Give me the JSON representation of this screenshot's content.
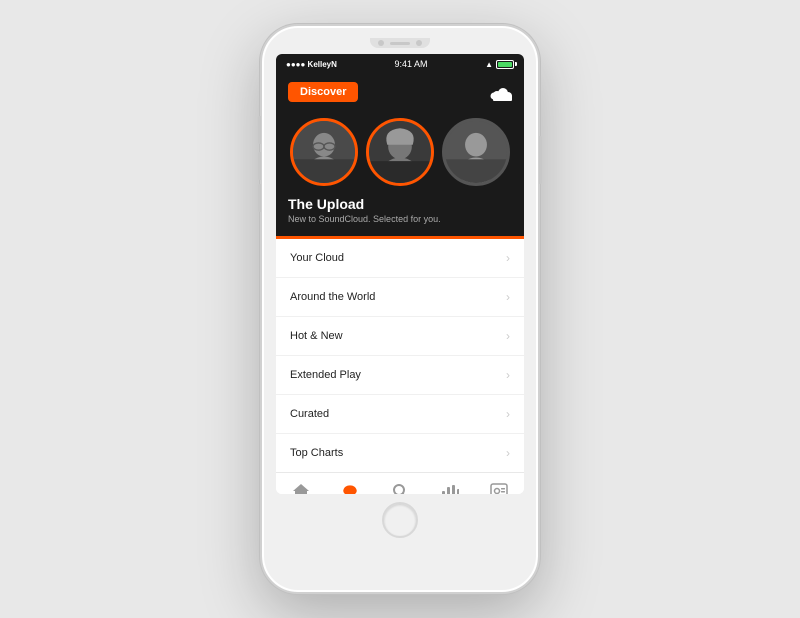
{
  "phone": {
    "status_bar": {
      "carrier": "●●●● KelleyN",
      "time": "9:41 AM",
      "battery": "100%"
    },
    "header": {
      "discover_label": "Discover",
      "logo_alt": "SoundCloud"
    },
    "hero": {
      "title": "The Upload",
      "subtitle": "New to SoundCloud. Selected for you."
    },
    "menu_items": [
      {
        "label": "Your Cloud"
      },
      {
        "label": "Around the World"
      },
      {
        "label": "Hot & New"
      },
      {
        "label": "Extended Play"
      },
      {
        "label": "Curated"
      },
      {
        "label": "Top Charts"
      }
    ],
    "bottom_nav": [
      {
        "label": "Home",
        "icon": "home",
        "active": false
      },
      {
        "label": "Discover",
        "icon": "discover",
        "active": true
      },
      {
        "label": "Search",
        "icon": "search",
        "active": false
      },
      {
        "label": "Playing",
        "icon": "playing",
        "active": false
      },
      {
        "label": "Library",
        "icon": "library",
        "active": false
      }
    ]
  }
}
